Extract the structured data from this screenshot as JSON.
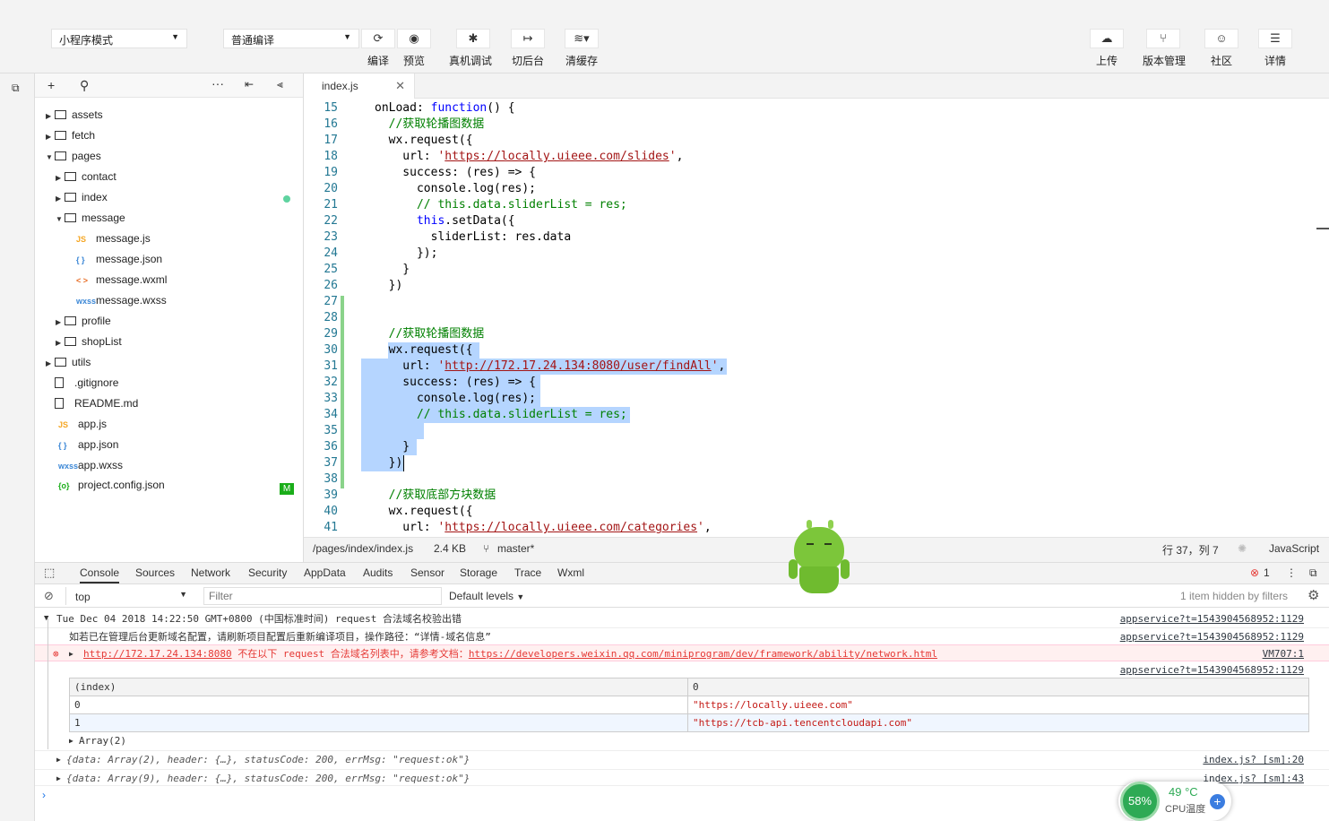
{
  "toolbar": {
    "mode_select": "小程序模式",
    "compile_select": "普通编译",
    "buttons": [
      {
        "label": "编译",
        "icon": "refresh-icon"
      },
      {
        "label": "预览",
        "icon": "eye-icon"
      },
      {
        "label": "真机调试",
        "icon": "bug-icon"
      },
      {
        "label": "切后台",
        "icon": "switch-icon"
      },
      {
        "label": "清缓存",
        "icon": "layers-icon"
      }
    ],
    "right_buttons": [
      {
        "label": "上传",
        "icon": "cloud-upload-icon"
      },
      {
        "label": "版本管理",
        "icon": "branch-icon"
      },
      {
        "label": "社区",
        "icon": "chat-icon"
      },
      {
        "label": "详情",
        "icon": "menu-icon"
      }
    ]
  },
  "tree": {
    "header_icons": [
      "plus-icon",
      "search-icon",
      "more-icon",
      "collapse-icon",
      "split-icon"
    ],
    "items": [
      {
        "label": "assets",
        "type": "folder",
        "depth": 0,
        "open": false
      },
      {
        "label": "fetch",
        "type": "folder",
        "depth": 0,
        "open": false
      },
      {
        "label": "pages",
        "type": "folder",
        "depth": 0,
        "open": true
      },
      {
        "label": "contact",
        "type": "folder",
        "depth": 1,
        "open": false
      },
      {
        "label": "index",
        "type": "folder",
        "depth": 1,
        "open": false
      },
      {
        "label": "message",
        "type": "folder",
        "depth": 1,
        "open": true
      },
      {
        "label": "message.js",
        "type": "js",
        "depth": 2
      },
      {
        "label": "message.json",
        "type": "json",
        "depth": 2
      },
      {
        "label": "message.wxml",
        "type": "wxml",
        "depth": 2
      },
      {
        "label": "message.wxss",
        "type": "wxss",
        "depth": 2
      },
      {
        "label": "profile",
        "type": "folder",
        "depth": 1,
        "open": false
      },
      {
        "label": "shopList",
        "type": "folder",
        "depth": 1,
        "open": false
      },
      {
        "label": "utils",
        "type": "folder",
        "depth": 0,
        "open": false
      },
      {
        "label": ".gitignore",
        "type": "file",
        "depth": 0
      },
      {
        "label": "README.md",
        "type": "file",
        "depth": 0
      },
      {
        "label": "app.js",
        "type": "js",
        "depth": 0
      },
      {
        "label": "app.json",
        "type": "json",
        "depth": 0
      },
      {
        "label": "app.wxss",
        "type": "wxss",
        "depth": 0
      },
      {
        "label": "project.config.json",
        "type": "config",
        "depth": 0
      }
    ],
    "badge_m": "M",
    "icon_labels": {
      "js": "JS",
      "json": "{ }",
      "wxml": "< >",
      "wxss": "wxss",
      "config": "{o}"
    }
  },
  "editor": {
    "tab": "index.js",
    "lines": [
      {
        "n": "15",
        "t": "onLoad: function() {"
      },
      {
        "n": "16",
        "t": "  //获取轮播图数据"
      },
      {
        "n": "17",
        "t": "  wx.request({"
      },
      {
        "n": "18",
        "t": "    url: 'https://locally.uieee.com/slides',"
      },
      {
        "n": "19",
        "t": "    success: (res) => {"
      },
      {
        "n": "20",
        "t": "      console.log(res);"
      },
      {
        "n": "21",
        "t": "      // this.data.sliderList = res;"
      },
      {
        "n": "22",
        "t": "      this.setData({"
      },
      {
        "n": "23",
        "t": "        sliderList: res.data"
      },
      {
        "n": "24",
        "t": "      });"
      },
      {
        "n": "25",
        "t": "    }"
      },
      {
        "n": "26",
        "t": "  })"
      },
      {
        "n": "27",
        "t": ""
      },
      {
        "n": "28",
        "t": ""
      },
      {
        "n": "29",
        "t": "  //获取轮播图数据"
      },
      {
        "n": "30",
        "t": "  wx.request({"
      },
      {
        "n": "31",
        "t": "    url: 'http://172.17.24.134:8080/user/findAll',"
      },
      {
        "n": "32",
        "t": "    success: (res) => {"
      },
      {
        "n": "33",
        "t": "      console.log(res);"
      },
      {
        "n": "34",
        "t": "      // this.data.sliderList = res;"
      },
      {
        "n": "35",
        "t": ""
      },
      {
        "n": "36",
        "t": "    }"
      },
      {
        "n": "37",
        "t": "  })"
      },
      {
        "n": "38",
        "t": ""
      },
      {
        "n": "39",
        "t": "  //获取底部方块数据"
      },
      {
        "n": "40",
        "t": "  wx.request({"
      },
      {
        "n": "41",
        "t": "    url: 'https://locally.uieee.com/categories',"
      }
    ]
  },
  "status": {
    "path": "/pages/index/index.js",
    "size": "2.4 KB",
    "branch": "master*",
    "cursor": "行 37，列 7",
    "lang": "JavaScript"
  },
  "devtools": {
    "tabs": [
      "Console",
      "Sources",
      "Network",
      "Security",
      "AppData",
      "Audits",
      "Sensor",
      "Storage",
      "Trace",
      "Wxml"
    ],
    "error_count": "1",
    "context": "top",
    "filter_placeholder": "Filter",
    "levels": "Default levels",
    "hidden": "1 item hidden by filters",
    "logs": {
      "group_title": "Tue Dec 04 2018 14:22:50 GMT+0800 (中国标准时间) request 合法域名校验出错",
      "group_src": "appservice?t=1543904568952:1129",
      "msg": "如若已在管理后台更新域名配置，请刷新项目配置后重新编译项目，操作路径：“详情-域名信息”",
      "msg_src": "appservice?t=1543904568952:1129",
      "err_url": "http://172.17.24.134:8080",
      "err_text": "不在以下 request 合法域名列表中，请参考文档：",
      "err_doc": "https://developers.weixin.qq.com/miniprogram/dev/framework/ability/network.html",
      "err_src": "VM707:1",
      "table_src": "appservice?t=1543904568952:1129",
      "table_head": [
        "(index)",
        "0"
      ],
      "table_rows": [
        [
          "0",
          "\"https://locally.uieee.com\""
        ],
        [
          "1",
          "\"https://tcb-api.tencentcloudapi.com\""
        ]
      ],
      "array_label": "Array(2)",
      "obj1": "{data: Array(2), header: {…}, statusCode: 200, errMsg: \"request:ok\"}",
      "obj1_src": "index.js? [sm]:20",
      "obj2": "{data: Array(9), header: {…}, statusCode: 200, errMsg: \"request:ok\"}",
      "obj2_src": "index.js? [sm]:43"
    }
  },
  "widget": {
    "cpu": "58%",
    "temp": "49 °C",
    "temp_label": "CPU温度"
  }
}
